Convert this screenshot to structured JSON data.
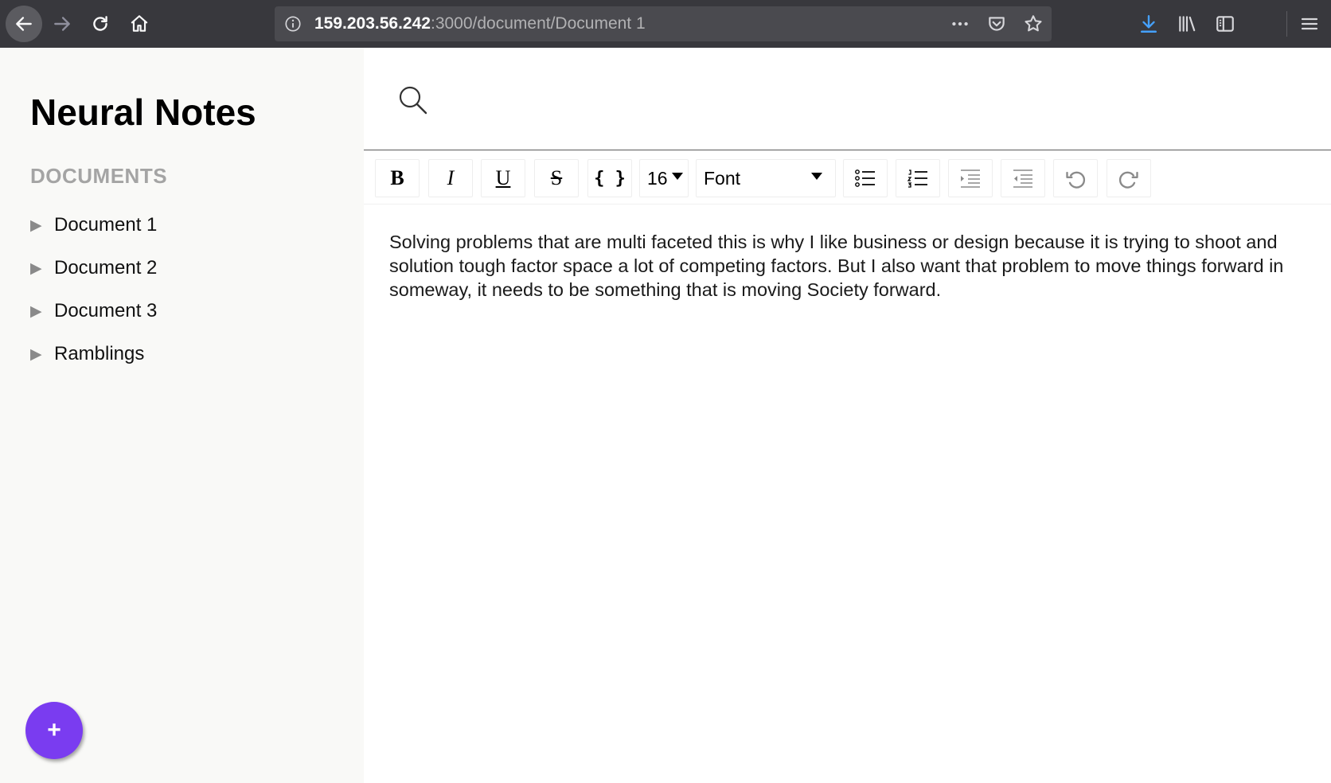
{
  "browser": {
    "url_host": "159.203.56.242",
    "url_path": ":3000/document/Document 1",
    "icons": [
      "back-icon",
      "forward-icon",
      "reload-icon",
      "home-icon",
      "info-icon",
      "more-icon",
      "pocket-icon",
      "bookmark-star-icon",
      "download-icon",
      "library-icon",
      "sidebar-toggle-icon",
      "hamburger-menu-icon"
    ]
  },
  "sidebar": {
    "title": "Neural Notes",
    "section_label": "DOCUMENTS",
    "items": [
      {
        "label": "Document 1"
      },
      {
        "label": "Document 2"
      },
      {
        "label": "Document 3"
      },
      {
        "label": "Ramblings"
      }
    ],
    "add_button_label": "+"
  },
  "toolbar": {
    "bold_label": "B",
    "italic_label": "I",
    "underline_label": "U",
    "strike_label": "S",
    "code_label": "{ }",
    "font_size": "16",
    "font_family": "Font"
  },
  "editor": {
    "content": "Solving problems that are multi faceted this is why I like business or design because it is trying to shoot and solution tough factor space a lot of competing factors. But I also want that problem to move things forward in someway, it needs to be something that is moving Society forward."
  },
  "colors": {
    "chrome_bg": "#38383d",
    "accent_download": "#45a1ff",
    "fab": "#7a3cf0",
    "sidebar_bg": "#f9f9f7"
  }
}
